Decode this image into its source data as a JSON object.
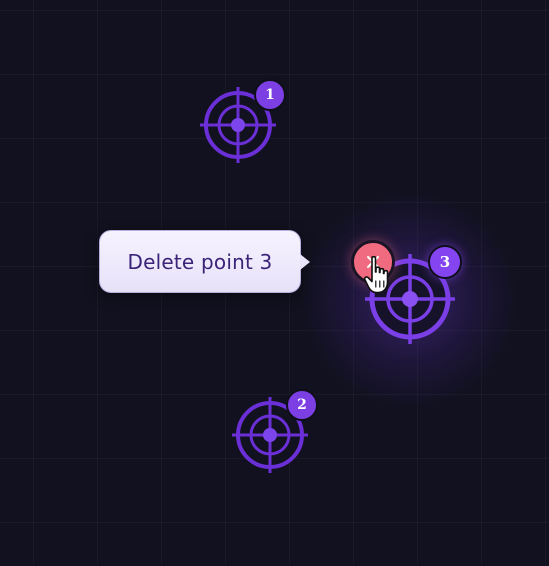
{
  "tooltip": {
    "text": "Delete point 3"
  },
  "points": [
    {
      "label": "1"
    },
    {
      "label": "2"
    },
    {
      "label": "3"
    }
  ],
  "colors": {
    "background": "#11111f",
    "target": "#6a2fd6",
    "target_active": "#7a3fe6",
    "badge": "#7b3fe4",
    "delete_button": "#f06b80",
    "tooltip_text": "#3b2377"
  },
  "icons": {
    "point": "crosshair-target-icon",
    "delete": "close-x-icon",
    "cursor": "hand-pointer-cursor-icon"
  }
}
